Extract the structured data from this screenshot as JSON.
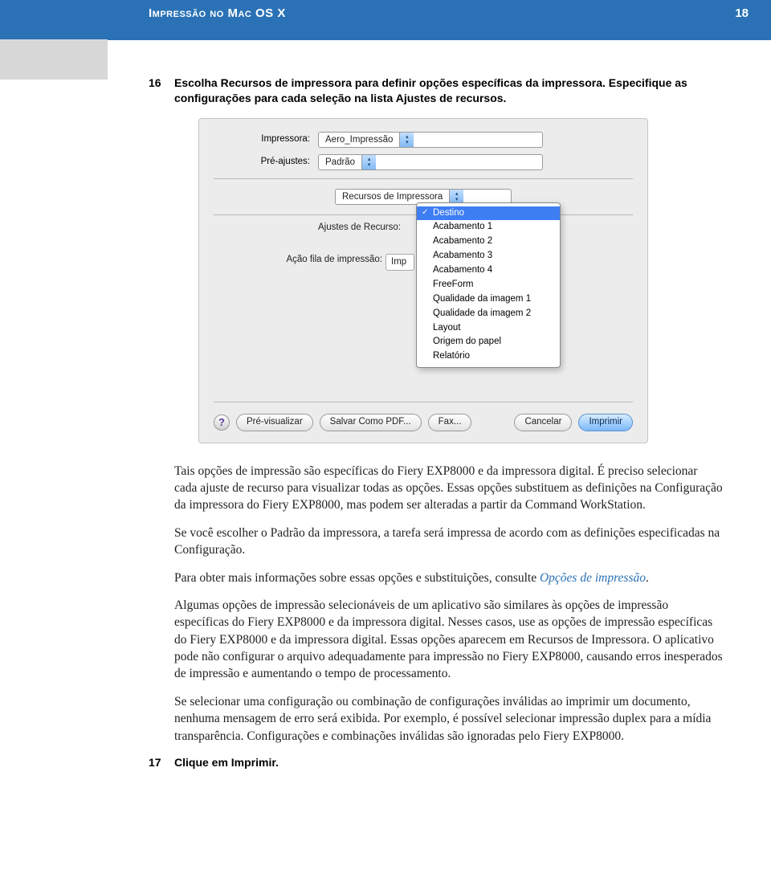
{
  "header": {
    "title": "Impressão no Mac OS X",
    "page": "18"
  },
  "steps": {
    "s16": {
      "num": "16",
      "title_a": "Escolha Recursos de impressora para definir opções específicas da impressora. Especifique as configurações para cada seleção na lista Ajustes de recursos."
    },
    "s17": {
      "num": "17",
      "title": "Clique em Imprimir."
    }
  },
  "dialog": {
    "labels": {
      "impressora": "Impressora:",
      "preajustes": "Pré-ajustes:",
      "ajustes": "Ajustes de Recurso:",
      "acao": "Ação fila de impressão:",
      "imp_val": "Imp"
    },
    "selects": {
      "impressora": "Aero_Impressão",
      "preajustes": "Padrão",
      "recursos": "Recursos de Impressora"
    },
    "menu": [
      "Destino",
      "Acabamento 1",
      "Acabamento 2",
      "Acabamento 3",
      "Acabamento 4",
      "FreeForm",
      "Qualidade da imagem 1",
      "Qualidade da imagem 2",
      "Layout",
      "Origem do papel",
      "Relatório"
    ],
    "help": "?",
    "buttons": {
      "prev": "Pré-visualizar",
      "savepdf": "Salvar Como PDF...",
      "fax": "Fax...",
      "cancelar": "Cancelar",
      "imprimir": "Imprimir"
    }
  },
  "body": {
    "p1": "Tais opções de impressão são específicas do Fiery EXP8000 e da impressora digital. É preciso selecionar cada ajuste de recurso para visualizar todas as opções. Essas opções substituem as definições na Configuração da impressora do Fiery EXP8000, mas podem ser alteradas a partir da Command WorkStation.",
    "p2": "Se você escolher o Padrão da impressora, a tarefa será impressa de acordo com as definições especificadas na  Configuração.",
    "p3a": "Para obter mais informações sobre essas opções e substituições, consulte ",
    "p3b": "Opções de impressão",
    "p3c": ".",
    "p4": "Algumas opções de impressão selecionáveis de um aplicativo são similares às opções de impressão específicas do Fiery EXP8000 e da impressora digital. Nesses casos, use as opções de impressão específicas do Fiery EXP8000 e da impressora digital. Essas opções aparecem em Recursos de Impressora. O aplicativo pode não configurar o arquivo adequadamente para impressão no Fiery EXP8000, causando erros inesperados de impressão e aumentando o tempo de processamento.",
    "p5": "Se selecionar uma configuração ou combinação de configurações inválidas ao imprimir um documento, nenhuma mensagem de erro será exibida. Por exemplo, é possível selecionar impressão duplex para a mídia transparência. Configurações e combinações inválidas são ignoradas pelo Fiery EXP8000."
  }
}
